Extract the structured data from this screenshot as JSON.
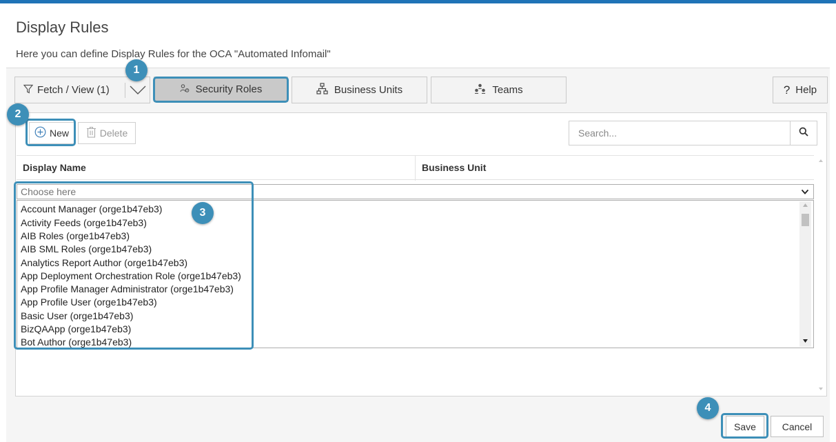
{
  "header": {
    "title": "Display Rules",
    "subtitle": "Here you can define Display Rules for the OCA \"Automated Infomail\""
  },
  "toolbar": {
    "fetch_label": "Fetch / View (1)",
    "tabs": [
      {
        "label": "Security Roles",
        "icon": "security-roles-icon",
        "selected": true
      },
      {
        "label": "Business Units",
        "icon": "org-chart-icon",
        "selected": false
      },
      {
        "label": "Teams",
        "icon": "teams-icon",
        "selected": false
      }
    ],
    "help_label": "Help"
  },
  "actions": {
    "new_label": "New",
    "delete_label": "Delete",
    "search_placeholder": "Search..."
  },
  "grid": {
    "columns": [
      "Display Name",
      "Business Unit"
    ],
    "combo_placeholder": "Choose here",
    "options": [
      "Account Manager (orge1b47eb3)",
      "Activity Feeds (orge1b47eb3)",
      "AIB Roles (orge1b47eb3)",
      "AIB SML Roles (orge1b47eb3)",
      "Analytics Report Author (orge1b47eb3)",
      "App Deployment Orchestration Role (orge1b47eb3)",
      "App Profile Manager Administrator (orge1b47eb3)",
      "App Profile User (orge1b47eb3)",
      "Basic User (orge1b47eb3)",
      "BizQAApp (orge1b47eb3)",
      "Bot Author (orge1b47eb3)"
    ]
  },
  "footer": {
    "save_label": "Save",
    "cancel_label": "Cancel"
  },
  "callouts": [
    "1",
    "2",
    "3",
    "4"
  ],
  "colors": {
    "accent": "#3d8fb8",
    "top_strip": "#1f73b7",
    "selected_tab": "#c9c9c9",
    "panel_bg": "#f5f5f5"
  }
}
